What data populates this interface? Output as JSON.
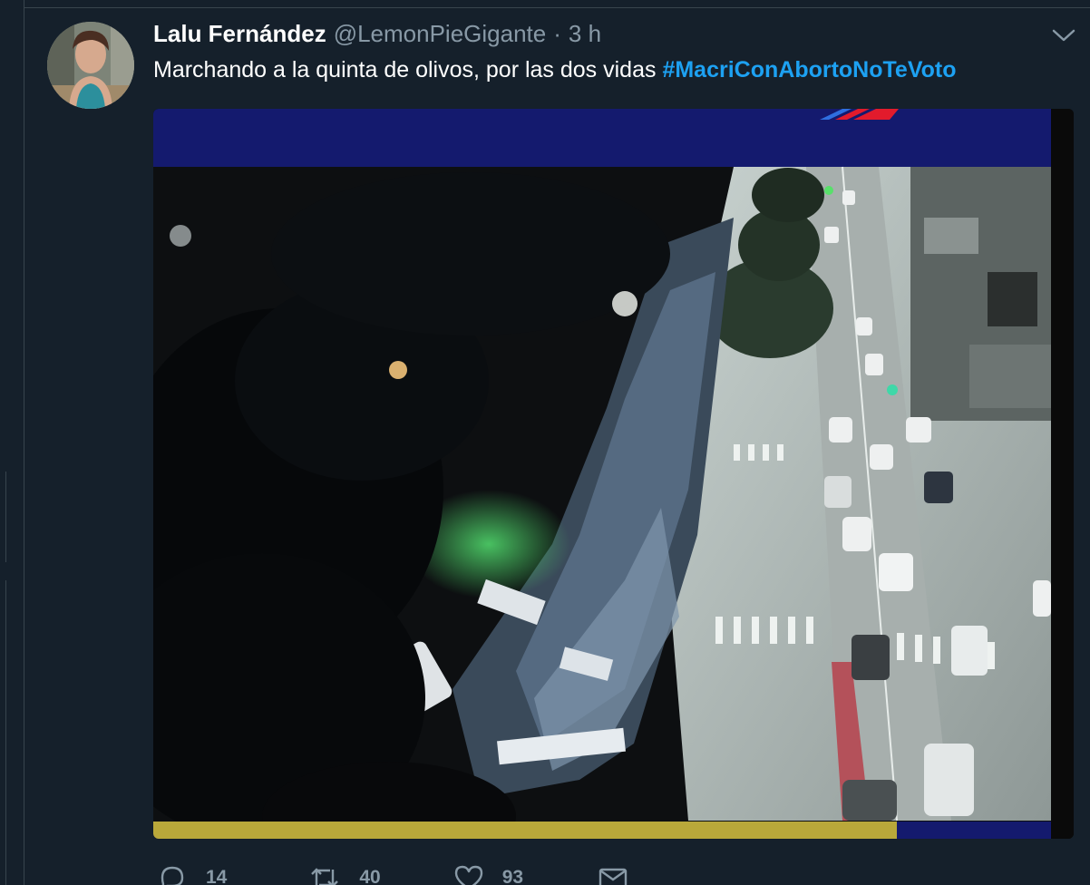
{
  "tweet": {
    "display_name": "Lalu Fernández",
    "handle": "@LemonPieGigante",
    "separator": "·",
    "time": "3 h",
    "text": "Marchando a la quinta de olivos, por las dos vidas ",
    "hashtag": "#MacriConAbortoNoTeVoto",
    "media": {
      "kind": "video",
      "subject": "aerial night view of a march along an avenue"
    }
  },
  "actions": {
    "replies": "14",
    "retweets": "40",
    "likes": "93"
  },
  "icons": {
    "caret": "chevron-down-icon",
    "reply": "reply-icon",
    "retweet": "retweet-icon",
    "like": "heart-icon",
    "message": "envelope-icon"
  },
  "colors": {
    "background": "#15202b",
    "text": "#ffffff",
    "secondary": "#8899a6",
    "link": "#1da1f2",
    "border": "#38444d",
    "broadcast_bar": "#141a6e",
    "progress_bar": "#b9a83a"
  }
}
